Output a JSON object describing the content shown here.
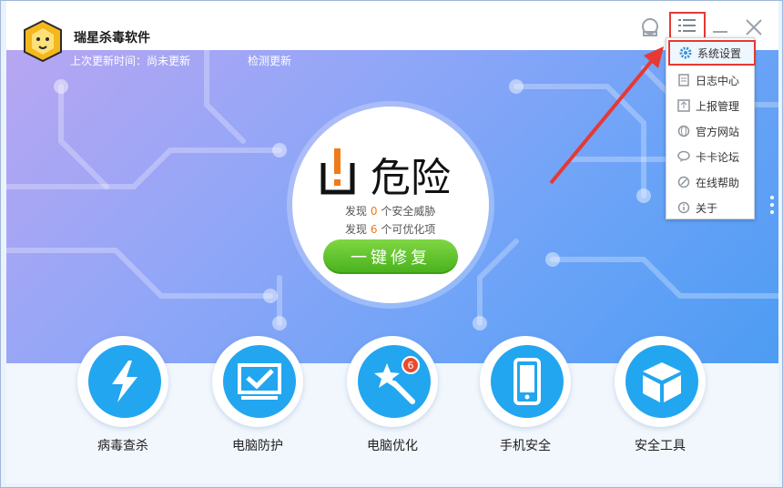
{
  "app": {
    "title": "瑞星杀毒软件"
  },
  "status": {
    "last_update": "上次更新时间：尚未更新",
    "check_update": "检测更新"
  },
  "danger": {
    "title": "危险",
    "threat_prefix": "发现",
    "threat_count": "0",
    "threat_suffix": "个安全威胁",
    "opt_prefix": "发现",
    "opt_count": "6",
    "opt_suffix": "个可优化项",
    "fix_label": "一键修复"
  },
  "menu": {
    "items": [
      {
        "label": "系统设置",
        "icon": "gear-icon"
      },
      {
        "label": "日志中心",
        "icon": "log-icon"
      },
      {
        "label": "上报管理",
        "icon": "upload-icon"
      },
      {
        "label": "官方网站",
        "icon": "globe-icon"
      },
      {
        "label": "卡卡论坛",
        "icon": "chat-icon"
      },
      {
        "label": "在线帮助",
        "icon": "help-icon"
      },
      {
        "label": "关于",
        "icon": "info-icon"
      }
    ]
  },
  "tools": [
    {
      "label": "病毒查杀",
      "icon": "lightning-icon"
    },
    {
      "label": "电脑防护",
      "icon": "monitor-check-icon"
    },
    {
      "label": "电脑优化",
      "icon": "magic-wand-icon",
      "badge": "6"
    },
    {
      "label": "手机安全",
      "icon": "phone-icon"
    },
    {
      "label": "安全工具",
      "icon": "box-icon"
    }
  ],
  "colors": {
    "accent_blue": "#22a6ef",
    "fix_green": "#5bc12a",
    "highlight_red": "#e53935",
    "count_orange": "#f07a1a"
  }
}
